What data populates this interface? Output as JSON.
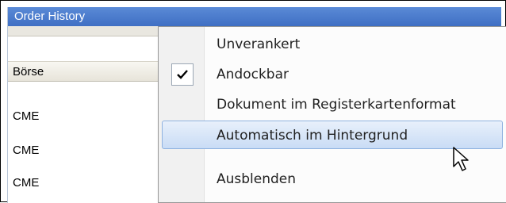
{
  "panel": {
    "title": "Order History",
    "column_header": "Börse",
    "rows": [
      "CME",
      "CME",
      "CME"
    ]
  },
  "context_menu": {
    "items": [
      {
        "label": "Unverankert",
        "checked": false,
        "highlighted": false
      },
      {
        "label": "Andockbar",
        "checked": true,
        "highlighted": false
      },
      {
        "label": "Dokument im Registerkartenformat",
        "checked": false,
        "highlighted": false
      },
      {
        "label": "Automatisch im Hintergrund",
        "checked": false,
        "highlighted": true
      },
      {
        "label": "Ausblenden",
        "checked": false,
        "highlighted": false
      }
    ]
  },
  "colors": {
    "title_bar": "#4a7ccc",
    "highlight": "#c9dcf5",
    "highlight_border": "#8fb2e0"
  }
}
